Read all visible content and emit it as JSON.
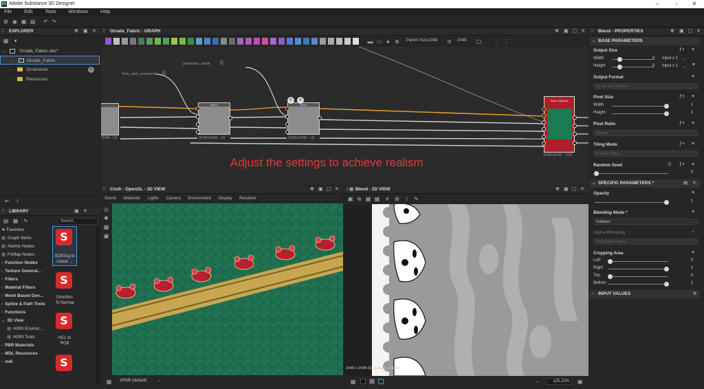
{
  "app": {
    "title": "Adobe Substance 3D Designer"
  },
  "menu": [
    "File",
    "Edit",
    "Tools",
    "Windows",
    "Help"
  ],
  "explorer": {
    "title": "EXPLORER",
    "package": "Ornate_Fabric.sbs*",
    "items": [
      "Ornate_Fabric",
      "Ornaments",
      "Resources"
    ]
  },
  "graph": {
    "title": "Ornate_Fabric - GRAPH",
    "parent_size_label": "Parent Size:",
    "parent_size_value": "2048",
    "parent_size_value2": "2048",
    "frame_trim": "Trim_and_ornaments",
    "frame_gen": "generator_mask",
    "node_blend1": "Blend",
    "node_blend2": "Blend",
    "node_base": "Base Material",
    "res_left": "2048 - L8",
    "res_mid": "2048x2048 - L8",
    "res_right": "2048x2048 - L8",
    "res_base": "2048x2048 - C16",
    "overlay_text": "Adjust the settings to achieve realism"
  },
  "library": {
    "title": "LIBRARY",
    "search_placeholder": "Search",
    "items": [
      {
        "label": "Favorites",
        "bold": false
      },
      {
        "label": "Graph Items",
        "bold": false
      },
      {
        "label": "Atomic Nodes",
        "bold": false
      },
      {
        "label": "FxMap Nodes",
        "bold": false
      },
      {
        "label": "Function Nodes",
        "bold": true
      },
      {
        "label": "Texture Generat...",
        "bold": true
      },
      {
        "label": "Filters",
        "bold": true
      },
      {
        "label": "Material Filters",
        "bold": true
      },
      {
        "label": "Mesh Based Gen...",
        "bold": true
      },
      {
        "label": "Spline & Path Tools",
        "bold": true
      },
      {
        "label": "Functions",
        "bold": true
      },
      {
        "label": "3D View",
        "bold": true
      },
      {
        "label": "HDRI Environ...",
        "bold": false
      },
      {
        "label": "HDRI Tools",
        "bold": false
      },
      {
        "label": "PBR Materials",
        "bold": true
      },
      {
        "label": "MDL Resources",
        "bold": true
      },
      {
        "label": "mdl",
        "bold": true
      }
    ],
    "thumbs": [
      {
        "l1": "ACEScg to",
        "l2": "Linear ..."
      },
      {
        "l1": "Direction",
        "l2": "To Normal"
      },
      {
        "l1": "HCL to",
        "l2": "RGB"
      },
      {
        "l1": "",
        "l2": ""
      }
    ]
  },
  "view3d": {
    "title": "Cloth - OpenGL - 3D VIEW",
    "menu": [
      "Scene",
      "Materials",
      "Lights",
      "Camera",
      "Environment",
      "Display",
      "Renderer"
    ],
    "colorspace": "sRGB (default)"
  },
  "view2d": {
    "title": "Blend - 2D VIEW",
    "status": "2048 x 2048 (Grayscale, 16bpc)",
    "zoom": "125.22%"
  },
  "properties": {
    "title": "Blend - PROPERTIES",
    "base_params": "BASE PARAMETERS",
    "output_size": "Output Size",
    "width": "Width",
    "height": "Height",
    "width_val": "0",
    "height_val": "0",
    "input_x1": "Input x 1",
    "input_x1b": "Input x 1",
    "output_format": "Output Format",
    "output_format_val": "16 bits per channel",
    "pixel_size": "Pixel Size",
    "px_width": "Width",
    "px_height": "Height",
    "px_w_val": "1",
    "px_h_val": "1",
    "pixel_ratio": "Pixel Ratio",
    "pixel_ratio_val": "Square",
    "tiling_mode": "Tiling Mode",
    "tiling_val": "H and V Tiling",
    "random_seed": "Random Seed",
    "seed_val": "0",
    "specific_params": "SPECIFIC PARAMETERS *",
    "opacity": "Opacity",
    "opacity_val": "1",
    "blending_mode": "Blending Mode *",
    "blending_val": "Subtract",
    "alpha_blending": "Alpha Blending",
    "alpha_val": "Use Source Alpha",
    "cropping_area": "Cropping Area",
    "left": "Left",
    "right": "Right",
    "top": "Top",
    "bottom": "Bottom",
    "left_val": "0",
    "right_val": "1",
    "top_val": "0",
    "bottom_val": "1",
    "input_values": "INPUT VALUES"
  }
}
